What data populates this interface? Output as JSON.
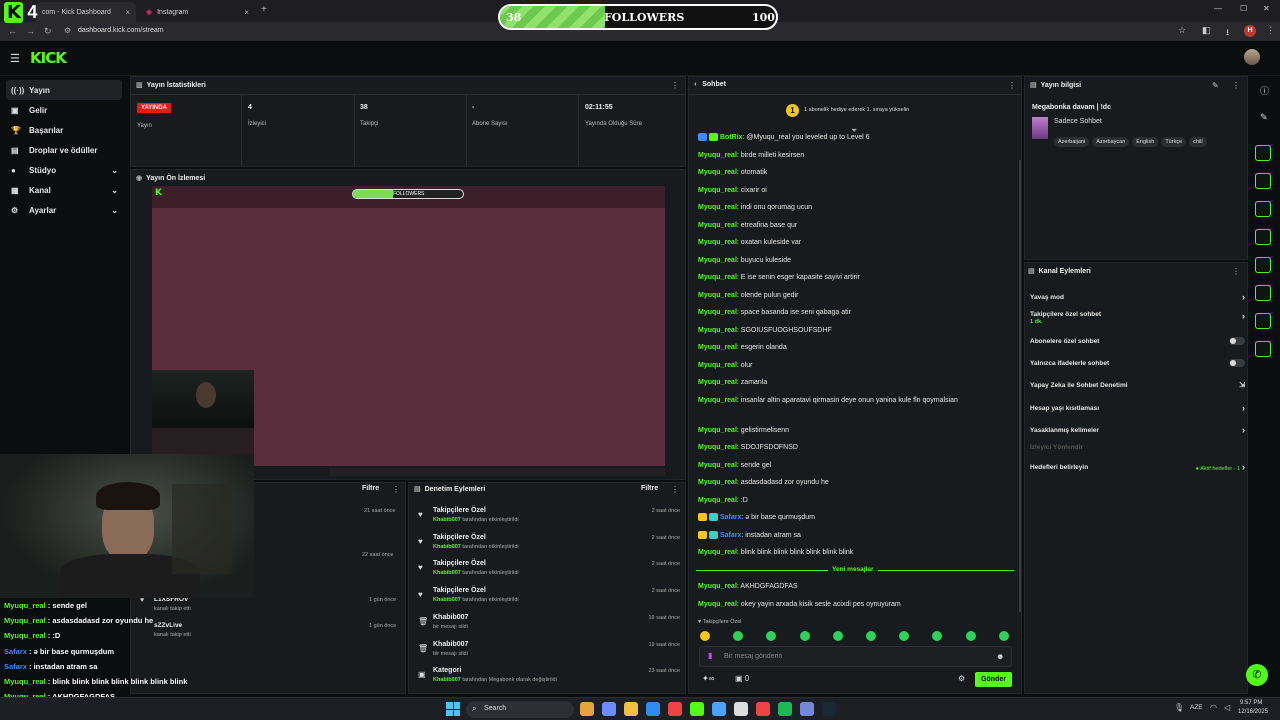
{
  "browser": {
    "tabs": [
      {
        "label": "com - Kick Dashboard",
        "close": "×"
      },
      {
        "label": "Instagram",
        "close": "×"
      }
    ],
    "new_tab": "+",
    "url": "dashboard.kick.com/stream",
    "nav": {
      "back": "←",
      "forward": "→",
      "reload": "↻"
    },
    "win": {
      "min": "—",
      "max": "☐",
      "close": "✕"
    },
    "profile_letter": "H"
  },
  "overlay": {
    "followers_current": "38",
    "followers_label": "FOLLOWERS",
    "followers_goal": "100",
    "followers_progress": 0.38,
    "chat": [
      {
        "user": "Myuqu_real",
        "text": " : sende gel",
        "style": "u"
      },
      {
        "user": "Myuqu_real",
        "text": " : asdasdadasd zor oyundu he",
        "style": "u"
      },
      {
        "user": "Myuqu_real",
        "text": " : :D",
        "style": "u"
      },
      {
        "user": "Safarx",
        "text": " : ə bir base qurmuşdum",
        "style": "b"
      },
      {
        "user": "Safarx",
        "text": " : instadan atram sa",
        "style": "b"
      },
      {
        "user": "Myuqu_real",
        "text": " : blink blink blink blink blink blink blink",
        "style": "u"
      },
      {
        "user": "Myuqu_real",
        "text": " : AKHDGFAGDFAS",
        "style": "u"
      },
      {
        "user": "Myuqu_real",
        "text": " : okey yayin arxada kisik sesle acixdi pes oynuyuram",
        "style": "u"
      }
    ]
  },
  "header": {
    "logo": "KICK"
  },
  "sidebar": {
    "items": [
      {
        "label": "Yayın",
        "icon": "((·))",
        "chev": ""
      },
      {
        "label": "Gelir",
        "icon": "▣",
        "chev": ""
      },
      {
        "label": "Başarılar",
        "icon": "🏆",
        "chev": ""
      },
      {
        "label": "Droplar ve ödüller",
        "icon": "▤",
        "chev": ""
      },
      {
        "label": "Stüdyo",
        "icon": "●",
        "chev": "⌄"
      },
      {
        "label": "Kanal",
        "icon": "▦",
        "chev": "⌄"
      },
      {
        "label": "Ayarlar",
        "icon": "⚙",
        "chev": "⌄"
      }
    ]
  },
  "stats": {
    "title": "Yayın İstatistikleri",
    "live_badge": "YAYINDA",
    "live_label": "Yayın",
    "items": [
      {
        "value": "4",
        "label": "İzleyici"
      },
      {
        "value": "38",
        "label": "Takipçi"
      },
      {
        "value": "-",
        "label": "Abone Sayısı"
      },
      {
        "value": "02:11:55",
        "label": "Yayında Olduğu Süre"
      }
    ]
  },
  "preview": {
    "title": "Yayın Ön İzlemesi",
    "inner_followers": "FOLLOWERS"
  },
  "activity": {
    "filter": "Filtre",
    "items": [
      {
        "name": "",
        "sub": "",
        "time": "21 saat önce"
      },
      {
        "name": "",
        "sub": "",
        "time": "22 saat önce"
      },
      {
        "name": "L1XSFROV",
        "sub": "kanalı takip etti",
        "time": "1 gün önce"
      },
      {
        "name": "sZZvLive",
        "sub": "kanalı takip etti",
        "time": "1 gün önce"
      }
    ]
  },
  "audit": {
    "title": "Denetim Eylemleri",
    "filter": "Filtre",
    "items": [
      {
        "title": "Takipçilere Özel",
        "user": "Khabib007",
        "rest": " tarafından etkinleştirildi",
        "time": "2 saat önce",
        "icon": "♥"
      },
      {
        "title": "Takipçilere Özel",
        "user": "Khabib007",
        "rest": " tarafından etkinleştirildi",
        "time": "2 saat önce",
        "icon": "♥"
      },
      {
        "title": "Takipçilere Özel",
        "user": "Khabib007",
        "rest": " tarafından etkinleştirildi",
        "time": "2 saat önce",
        "icon": "♥"
      },
      {
        "title": "Takipçilere Özel",
        "user": "Khabib007",
        "rest": " tarafından etkinleştirildi",
        "time": "2 saat önce",
        "icon": "♥"
      },
      {
        "title": "Khabib007",
        "user": "",
        "rest": "bir mesajı sildi",
        "time": "19 saat önce",
        "icon": "🗑"
      },
      {
        "title": "Khabib007",
        "user": "",
        "rest": "bir mesajı sildi",
        "time": "19 saat önce",
        "icon": "🗑"
      },
      {
        "title": "Kategori",
        "user": "Khabib007",
        "rest": " tarafından Megabonk olarak değiştirildi",
        "time": "23 saat önce",
        "icon": "▣"
      }
    ]
  },
  "chat": {
    "title": "Sohbet",
    "sub_gift": "1 abonelik hediye ederek 1. sıraya yükselin",
    "messages": [
      {
        "user": "BotRix",
        "text": ": @Myuqu_real you leveled up to Level 6",
        "kind": "bot"
      },
      {
        "user": "Myuqu_real",
        "text": ": birde milleti kesirsen",
        "kind": "u"
      },
      {
        "user": "Myuqu_real",
        "text": ": otomatik",
        "kind": "u"
      },
      {
        "user": "Myuqu_real",
        "text": ": cixarir oi",
        "kind": "u"
      },
      {
        "user": "Myuqu_real",
        "text": ": indi onu qorumag ucun",
        "kind": "u"
      },
      {
        "user": "Myuqu_real",
        "text": ": etreafina base qur",
        "kind": "u"
      },
      {
        "user": "Myuqu_real",
        "text": ": oxatan kuleside var",
        "kind": "u"
      },
      {
        "user": "Myuqu_real",
        "text": ": buyucu kuleside",
        "kind": "u"
      },
      {
        "user": "Myuqu_real",
        "text": ": E ise senin esger kapasite sayivi artirir",
        "kind": "u"
      },
      {
        "user": "Myuqu_real",
        "text": ": olende pulun gedir",
        "kind": "u"
      },
      {
        "user": "Myuqu_real",
        "text": ": space basanda ise seni qabaga atir",
        "kind": "u"
      },
      {
        "user": "Myuqu_real",
        "text": ": SGOIUSFUOGHSOUFSDHF",
        "kind": "u"
      },
      {
        "user": "Myuqu_real",
        "text": ": esgerin olanda",
        "kind": "u"
      },
      {
        "user": "Myuqu_real",
        "text": ": olur",
        "kind": "u"
      },
      {
        "user": "Myuqu_real",
        "text": ": zamanla",
        "kind": "u"
      },
      {
        "user": "Myuqu_real",
        "text": ": insanlar altin aparatavi qirmasin deye onun yanina kule fln qoymalsian",
        "kind": "u2"
      },
      {
        "user": "Myuqu_real",
        "text": ": gelistirmelisenn",
        "kind": "u"
      },
      {
        "user": "Myuqu_real",
        "text": ": SDOJFSDOFNSD",
        "kind": "u"
      },
      {
        "user": "Myuqu_real",
        "text": ": sende gel",
        "kind": "u"
      },
      {
        "user": "Myuqu_real",
        "text": ": asdasdadasd zor oyundu he",
        "kind": "u"
      },
      {
        "user": "Myuqu_real",
        "text": ": :D",
        "kind": "u"
      },
      {
        "user": "Safarx",
        "text": ": ə bir base qurmuşdum",
        "kind": "b"
      },
      {
        "user": "Safarx",
        "text": ": instadan atram sa",
        "kind": "b"
      },
      {
        "user": "Myuqu_real",
        "text": ": blink blink blink blink blink blink blink",
        "kind": "u"
      }
    ],
    "new_messages": "Yeni mesajlar",
    "after": [
      {
        "user": "Myuqu_real",
        "text": ": AKHDGFAGDFAS"
      },
      {
        "user": "Myuqu_real",
        "text": ": okey yayin arxada kisik sesle acixdi pes oynuyuram"
      }
    ],
    "followers_only": "♥ Takipçilere Özel",
    "placeholder": "Bir mesaj gönderin",
    "points": "∞",
    "zero": "0",
    "send": "Gönder"
  },
  "stream_info": {
    "title": "Yayın bilgisi",
    "stream_title": "Megabonka davam | !dc",
    "category": "Sadece Sohbet",
    "tags": [
      "Azerbaijani",
      "Azərbaycan",
      "English",
      "Türkçe",
      "chill"
    ]
  },
  "channel_actions": {
    "title": "Kanal Eylemleri",
    "slow_mode": "Yavaş mod",
    "followers_chat": "Takipçilere özel sohbet",
    "followers_chat_sub": "1 dk.",
    "subs_chat": "Abonelere özel sohbet",
    "emotes_chat": "Yalnızca ifadelerle sohbet",
    "ai_mod": "Yapay Zeka ile Sohbet Denetimi",
    "account_age": "Hesap yaşı kısıtlaması",
    "banned_words": "Yasaklanmış kelimeler",
    "viewer_redirect": "İzleyici Yönlendir",
    "goals": "Hedefleri belirleyin",
    "goals_status": "● Aktif hedefler - 1"
  },
  "taskbar": {
    "search": "Search",
    "lang": "AZE",
    "time": "9:57 PM",
    "date": "12/16/2025"
  },
  "colors": {
    "accent": "#53fc18",
    "live": "#e91916",
    "blue": "#3a8cff"
  }
}
